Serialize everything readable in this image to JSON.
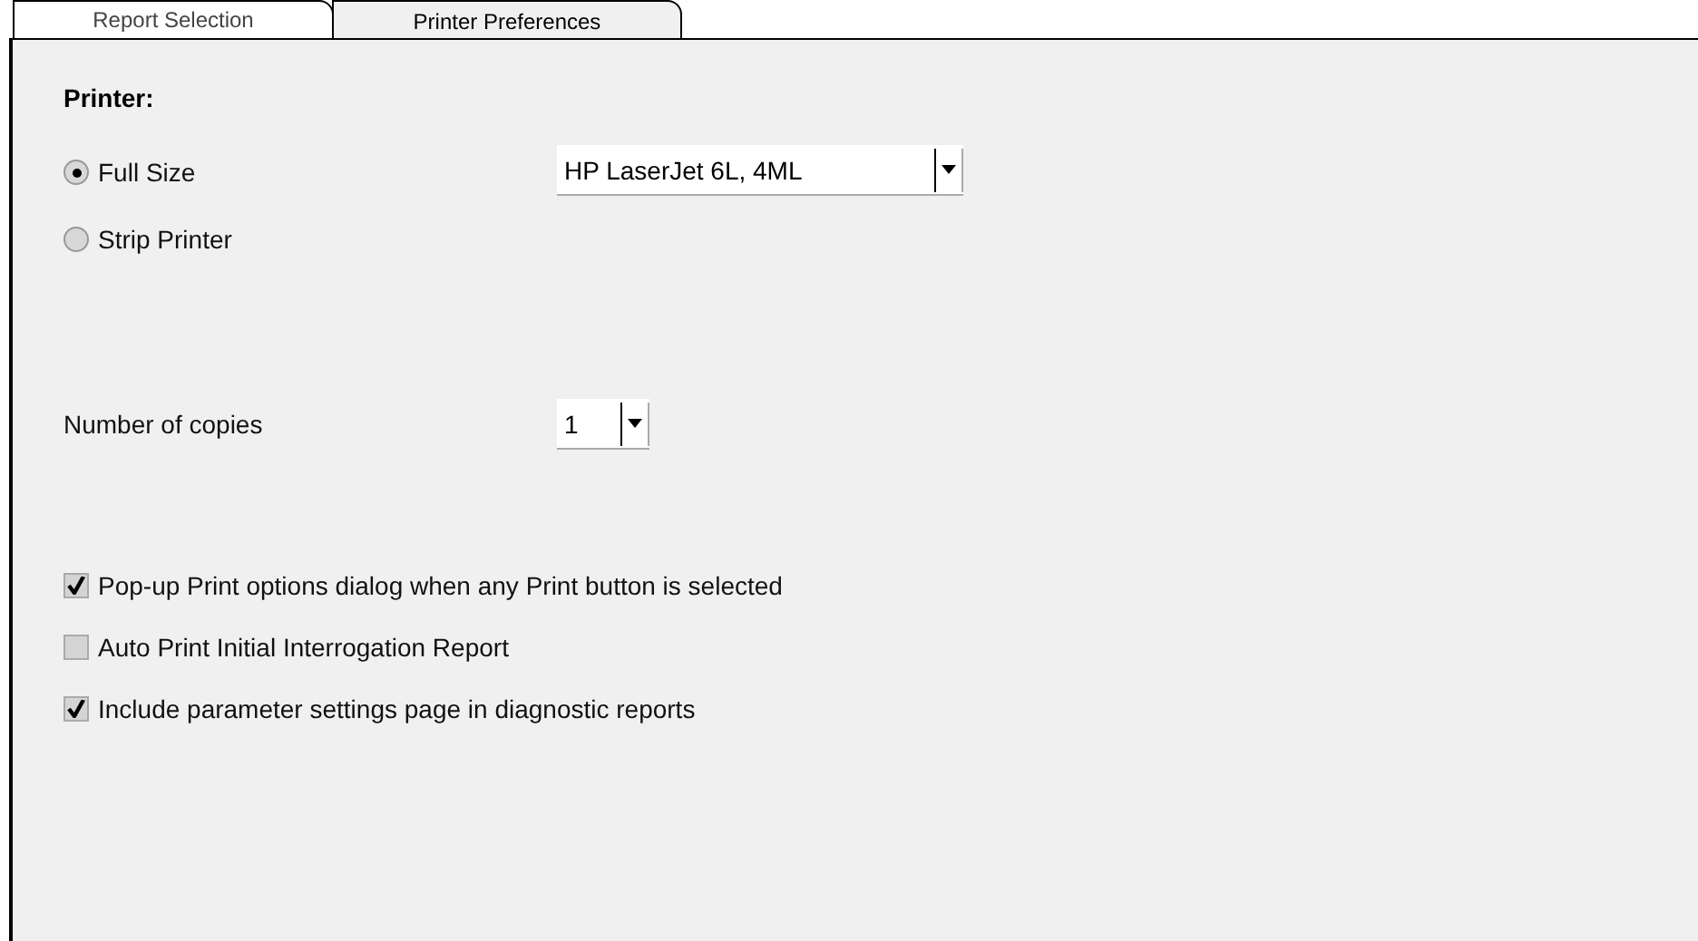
{
  "tabs": [
    {
      "label": "Report Selection",
      "selected": false
    },
    {
      "label": "Printer Preferences",
      "selected": true
    }
  ],
  "printer": {
    "heading": "Printer:",
    "options": [
      {
        "label": "Full Size",
        "selected": true
      },
      {
        "label": "Strip Printer",
        "selected": false
      }
    ],
    "dropdown": {
      "value": "HP LaserJet 6L, 4ML"
    }
  },
  "copies": {
    "label": "Number of copies",
    "value": "1"
  },
  "checkboxes": [
    {
      "label": "Pop-up Print options dialog when any Print button is selected",
      "checked": true
    },
    {
      "label": "Auto Print Initial Interrogation Report",
      "checked": false
    },
    {
      "label": "Include parameter settings page in diagnostic reports",
      "checked": true
    }
  ]
}
